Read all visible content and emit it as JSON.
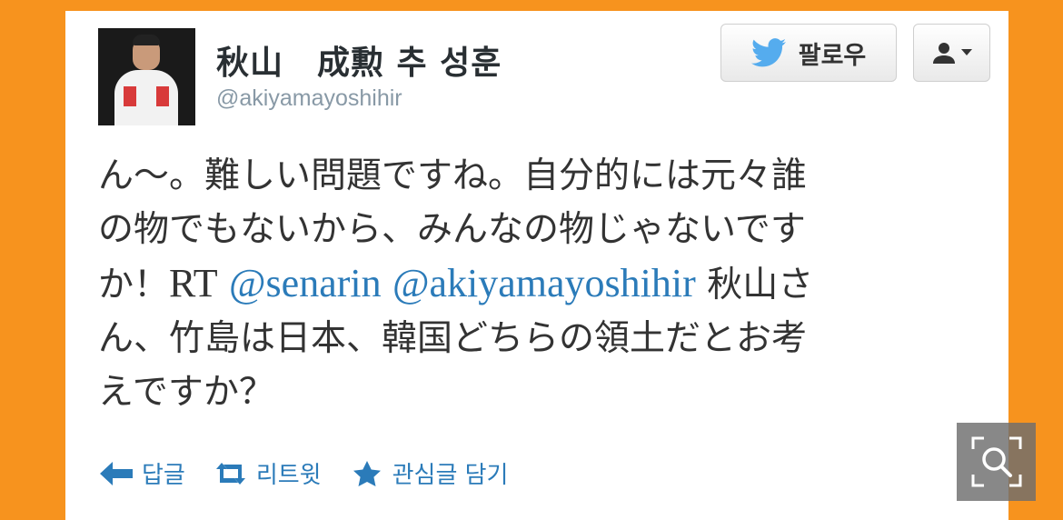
{
  "profile": {
    "display_name": "秋山　成勲 추 성훈",
    "handle": "@akiyamayoshihir"
  },
  "buttons": {
    "follow_label": "팔로우",
    "follow_icon": "twitter-bird-icon",
    "user_menu_icon": "user-dropdown-icon"
  },
  "tweet": {
    "line1": "ん～。難しい問題ですね。自分的には元々誰",
    "line2": "の物でもないから、みんなの物じゃないです",
    "line3_prefix": "か！",
    "rt_text": "RT",
    "mention1": "@senarin",
    "mention2": "@akiyamayoshihir",
    "line3_suffix": "秋山さ",
    "line4": "ん、竹島は日本、韓国どちらの領土だとお考",
    "line5": "えですか？"
  },
  "actions": {
    "reply": "답글",
    "retweet": "리트윗",
    "favorite": "관심글 담기"
  },
  "overlay": {
    "zoom_icon": "zoom-search-icon"
  },
  "colors": {
    "background": "#f7931e",
    "link": "#2b7bb9",
    "twitter_blue": "#55acee"
  }
}
